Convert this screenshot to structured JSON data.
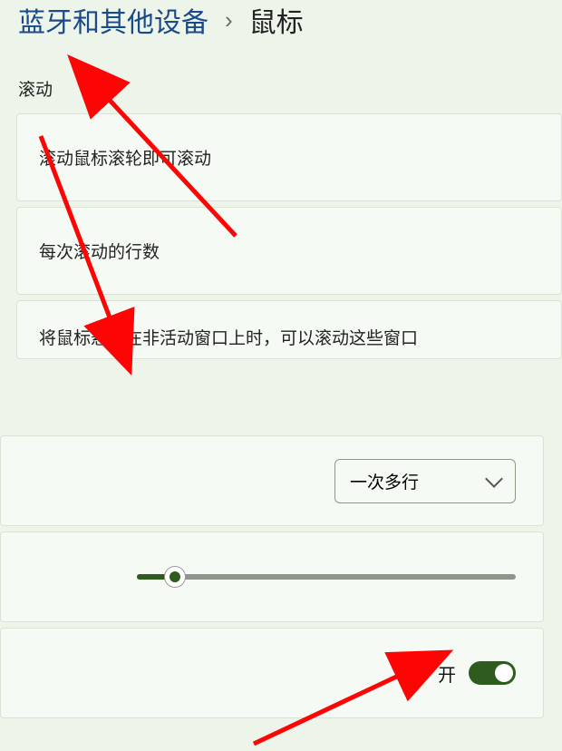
{
  "breadcrumb": {
    "parent": "蓝牙和其他设备",
    "current": "鼠标"
  },
  "section": {
    "scroll_label": "滚动"
  },
  "rows": {
    "scroll_wheel": "滚动鼠标滚轮即可滚动",
    "lines_per_scroll": "每次滚动的行数",
    "hover_inactive": "将鼠标悬停在非活动窗口上时，可以滚动这些窗口"
  },
  "controls": {
    "scroll_mode_value": "一次多行",
    "toggle_label": "开",
    "toggle_state": "on",
    "slider_percent": 10
  },
  "colors": {
    "accent": "#2e5c1f",
    "arrow": "#fd0505"
  }
}
